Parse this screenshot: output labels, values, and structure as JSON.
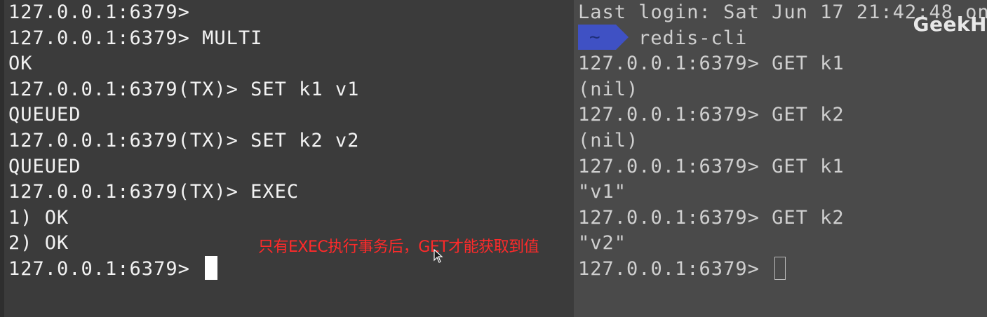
{
  "left_terminal": {
    "lines": [
      "127.0.0.1:6379>",
      "127.0.0.1:6379> MULTI",
      "OK",
      "127.0.0.1:6379(TX)> SET k1 v1",
      "QUEUED",
      "127.0.0.1:6379(TX)> SET k2 v2",
      "QUEUED",
      "127.0.0.1:6379(TX)> EXEC",
      "1) OK",
      "2) OK",
      "127.0.0.1:6379> "
    ]
  },
  "right_terminal": {
    "last_login": "Last login: Sat Jun 17 21:42:48 on",
    "prompt_symbol": "~",
    "command": "redis-cli",
    "lines": [
      "127.0.0.1:6379> GET k1",
      "(nil)",
      "127.0.0.1:6379> GET k2",
      "(nil)",
      "127.0.0.1:6379> GET k1",
      "\"v1\"",
      "127.0.0.1:6379> GET k2",
      "\"v2\"",
      "127.0.0.1:6379> "
    ],
    "prompt_color": "#3f51c4"
  },
  "watermark": "GeekH",
  "annotation": {
    "text": "只有EXEC执行事务后，GET才能获取到值",
    "color": "#ff2a2a"
  }
}
